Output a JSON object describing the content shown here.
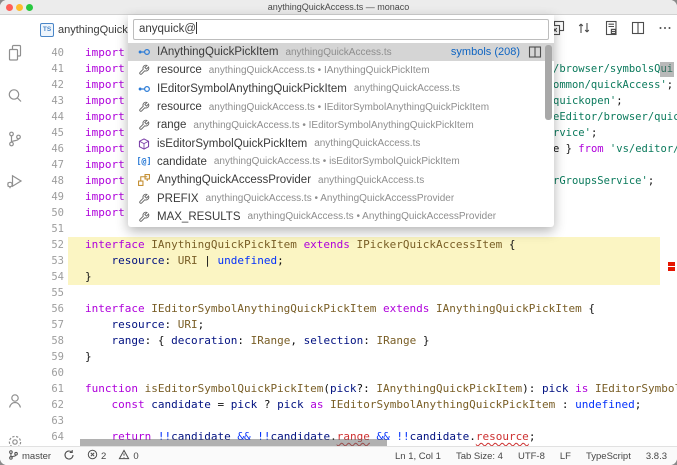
{
  "window": {
    "title": "anythingQuickAccess.ts — monaco"
  },
  "colors": {
    "traffic_red": "#ff5f57",
    "traffic_yellow": "#febc2e",
    "traffic_green": "#28c840",
    "keyword": "#AF00DB",
    "type": "#795E26",
    "variable": "#001080",
    "string": "#0B7A5C",
    "operator": "#0431FA",
    "error": "#CD3131",
    "line_highlight": "#fbf5c3",
    "selected_row": "#d5d5d5",
    "link": "#0E64C2",
    "ruler_marker": "#e51400"
  },
  "activity_bar": {
    "top_items": [
      "explorer",
      "search",
      "source-control",
      "run-debug"
    ],
    "bottom_items": [
      "accounts",
      "settings"
    ]
  },
  "tab": {
    "file_type": "TS",
    "label": "anythingQuick"
  },
  "toolbar": {
    "icons": [
      "open-changes",
      "compare",
      "notebook",
      "split-editor",
      "more-actions"
    ]
  },
  "quick_input": {
    "value": "anyquick@",
    "items": [
      {
        "icon": "interface",
        "name": "IAnythingQuickPickItem",
        "desc": "anythingQuickAccess.ts",
        "selected": true,
        "badge": "symbols (208)"
      },
      {
        "icon": "property",
        "name": "resource",
        "desc": "anythingQuickAccess.ts • IAnythingQuickPickItem"
      },
      {
        "icon": "interface",
        "name": "IEditorSymbolAnythingQuickPickItem",
        "desc": "anythingQuickAccess.ts"
      },
      {
        "icon": "property",
        "name": "resource",
        "desc": "anythingQuickAccess.ts • IEditorSymbolAnythingQuickPickItem"
      },
      {
        "icon": "property",
        "name": "range",
        "desc": "anythingQuickAccess.ts • IEditorSymbolAnythingQuickPickItem"
      },
      {
        "icon": "method",
        "name": "isEditorSymbolQuickPickItem",
        "desc": "anythingQuickAccess.ts"
      },
      {
        "icon": "variable",
        "name": "candidate",
        "desc": "anythingQuickAccess.ts • isEditorSymbolQuickPickItem"
      },
      {
        "icon": "class",
        "name": "AnythingQuickAccessProvider",
        "desc": "anythingQuickAccess.ts"
      },
      {
        "icon": "property",
        "name": "PREFIX",
        "desc": "anythingQuickAccess.ts • AnythingQuickAccessProvider"
      },
      {
        "icon": "property",
        "name": "MAX_RESULTS",
        "desc": "anythingQuickAccess.ts • AnythingQuickAccessProvider"
      }
    ]
  },
  "editor": {
    "lines": [
      {
        "n": 40,
        "tokens": [
          [
            "k",
            "import"
          ]
        ]
      },
      {
        "n": 41,
        "tokens": [
          [
            "k",
            "import"
          ]
        ],
        "tail": [
          [
            "s",
            "/browser/symbolsQui"
          ]
        ]
      },
      {
        "n": 42,
        "tokens": [
          [
            "k",
            "import"
          ]
        ],
        "tail": [
          [
            "s",
            "ommon/quickAccess'"
          ],
          [
            "p",
            ";"
          ]
        ]
      },
      {
        "n": 43,
        "tokens": [
          [
            "k",
            "import"
          ]
        ],
        "tail": [
          [
            "s",
            "quickopen'"
          ],
          [
            "p",
            ";"
          ]
        ]
      },
      {
        "n": 44,
        "tokens": [
          [
            "k",
            "import"
          ]
        ],
        "tail": [
          [
            "s",
            "eEditor/browser/quic"
          ]
        ]
      },
      {
        "n": 45,
        "tokens": [
          [
            "k",
            "import"
          ]
        ],
        "tail": [
          [
            "s",
            "rvice'"
          ],
          [
            "p",
            ";"
          ]
        ]
      },
      {
        "n": 46,
        "tokens": [
          [
            "k",
            "import"
          ]
        ],
        "tail": [
          [
            "p",
            "e } "
          ],
          [
            "k",
            "from"
          ],
          [
            "p",
            " "
          ],
          [
            "s",
            "'vs/editor/"
          ]
        ]
      },
      {
        "n": 47,
        "tokens": [
          [
            "k",
            "import"
          ]
        ]
      },
      {
        "n": 48,
        "tokens": [
          [
            "k",
            "import"
          ]
        ],
        "tail": [
          [
            "s",
            "rGroupsService'"
          ],
          [
            "p",
            ";"
          ]
        ]
      },
      {
        "n": 49,
        "tokens": [
          [
            "k",
            "import"
          ]
        ]
      },
      {
        "n": 50,
        "tokens": [
          [
            "k",
            "import"
          ]
        ]
      },
      {
        "n": 51,
        "tokens": []
      },
      {
        "n": 52,
        "hl": true,
        "tokens": [
          [
            "k",
            "interface"
          ],
          [
            "p",
            " "
          ],
          [
            "t",
            "IAnythingQuickPickItem"
          ],
          [
            "p",
            " "
          ],
          [
            "k",
            "extends"
          ],
          [
            "p",
            " "
          ],
          [
            "t",
            "IPickerQuickAccessItem"
          ],
          [
            "p",
            " {"
          ]
        ]
      },
      {
        "n": 53,
        "hl": true,
        "tokens": [
          [
            "p",
            "    "
          ],
          [
            "v",
            "resource"
          ],
          [
            "p",
            ": "
          ],
          [
            "t",
            "URI"
          ],
          [
            "p",
            " | "
          ],
          [
            "b",
            "undefined"
          ],
          [
            "p",
            ";"
          ]
        ]
      },
      {
        "n": 54,
        "hl": true,
        "tokens": [
          [
            "p",
            "}"
          ]
        ]
      },
      {
        "n": 55,
        "tokens": []
      },
      {
        "n": 56,
        "tokens": [
          [
            "k",
            "interface"
          ],
          [
            "p",
            " "
          ],
          [
            "t",
            "IEditorSymbolAnythingQuickPickItem"
          ],
          [
            "p",
            " "
          ],
          [
            "k",
            "extends"
          ],
          [
            "p",
            " "
          ],
          [
            "t",
            "IAnythingQuickPickItem"
          ],
          [
            "p",
            " {"
          ]
        ]
      },
      {
        "n": 57,
        "tokens": [
          [
            "p",
            "    "
          ],
          [
            "v",
            "resource"
          ],
          [
            "p",
            ": "
          ],
          [
            "t",
            "URI"
          ],
          [
            "p",
            ";"
          ]
        ]
      },
      {
        "n": 58,
        "tokens": [
          [
            "p",
            "    "
          ],
          [
            "v",
            "range"
          ],
          [
            "p",
            ": { "
          ],
          [
            "v",
            "decoration"
          ],
          [
            "p",
            ": "
          ],
          [
            "t",
            "IRange"
          ],
          [
            "p",
            ", "
          ],
          [
            "v",
            "selection"
          ],
          [
            "p",
            ": "
          ],
          [
            "t",
            "IRange"
          ],
          [
            "p",
            " }"
          ]
        ]
      },
      {
        "n": 59,
        "tokens": [
          [
            "p",
            "}"
          ]
        ]
      },
      {
        "n": 60,
        "tokens": []
      },
      {
        "n": 61,
        "tokens": [
          [
            "k",
            "function"
          ],
          [
            "p",
            " "
          ],
          [
            "t",
            "isEditorSymbolQuickPickItem"
          ],
          [
            "p",
            "("
          ],
          [
            "v",
            "pick"
          ],
          [
            "p",
            "?: "
          ],
          [
            "t",
            "IAnythingQuickPickItem"
          ],
          [
            "p",
            "): "
          ],
          [
            "v",
            "pick"
          ],
          [
            "p",
            " "
          ],
          [
            "k",
            "is"
          ],
          [
            "p",
            " "
          ],
          [
            "t",
            "IEditorSymbolAnythingQuickPickItem"
          ]
        ]
      },
      {
        "n": 62,
        "tokens": [
          [
            "p",
            "    "
          ],
          [
            "k",
            "const"
          ],
          [
            "p",
            " "
          ],
          [
            "v",
            "candidate"
          ],
          [
            "p",
            " = "
          ],
          [
            "v",
            "pick"
          ],
          [
            "p",
            " ? "
          ],
          [
            "v",
            "pick"
          ],
          [
            "p",
            " "
          ],
          [
            "k",
            "as"
          ],
          [
            "p",
            " "
          ],
          [
            "t",
            "IEditorSymbolAnythingQuickPickItem"
          ],
          [
            "p",
            " : "
          ],
          [
            "b",
            "undefined"
          ],
          [
            "p",
            ";"
          ]
        ]
      },
      {
        "n": 63,
        "tokens": []
      },
      {
        "n": 64,
        "tokens": [
          [
            "p",
            "    "
          ],
          [
            "k",
            "return"
          ],
          [
            "p",
            " "
          ],
          [
            "b",
            "!!"
          ],
          [
            "v",
            "candidate"
          ],
          [
            "p",
            " "
          ],
          [
            "b",
            "&&"
          ],
          [
            "p",
            " "
          ],
          [
            "b",
            "!!"
          ],
          [
            "v",
            "candidate"
          ],
          [
            "p",
            "."
          ],
          [
            "e",
            "range"
          ],
          [
            "p",
            " "
          ],
          [
            "b",
            "&&"
          ],
          [
            "p",
            " "
          ],
          [
            "b",
            "!!"
          ],
          [
            "v",
            "candidate"
          ],
          [
            "p",
            "."
          ],
          [
            "e",
            "resource"
          ],
          [
            "p",
            ";"
          ]
        ]
      }
    ]
  },
  "status_bar": {
    "left": [
      {
        "icon": "branch",
        "label": "master"
      },
      {
        "icon": "sync",
        "label": ""
      },
      {
        "icon": "error",
        "label": "2"
      },
      {
        "icon": "warning",
        "label": "0"
      }
    ],
    "right": [
      "Ln 1, Col 1",
      "Tab Size: 4",
      "UTF-8",
      "LF",
      "TypeScript",
      "3.8.3"
    ]
  }
}
